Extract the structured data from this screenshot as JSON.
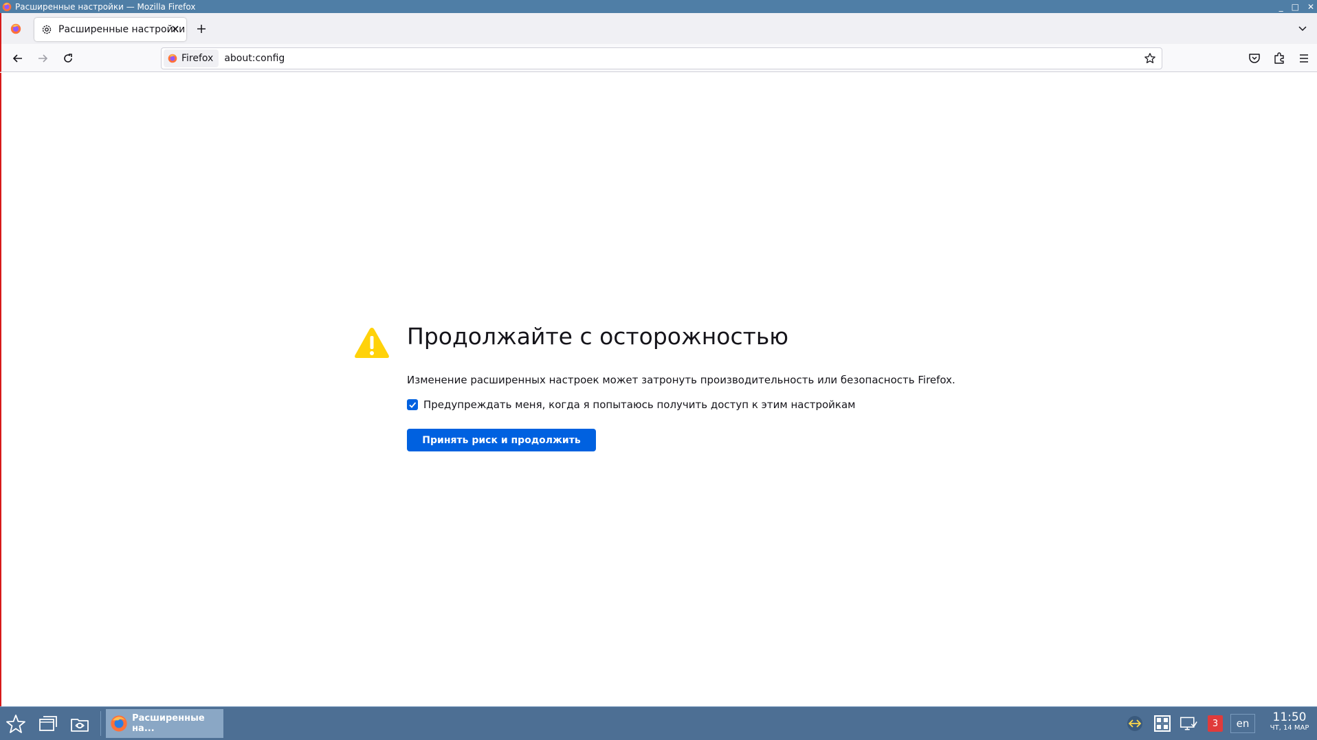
{
  "window": {
    "title": "Расширенные настройки — Mozilla Firefox",
    "controls": [
      "_",
      "□",
      "✕"
    ]
  },
  "tabs": [
    {
      "label": "Расширенные настройки",
      "icon": "gear-icon",
      "active": true
    }
  ],
  "navbar": {
    "identity_label": "Firefox",
    "url": "about:config"
  },
  "page": {
    "heading": "Продолжайте с осторожностью",
    "description": "Изменение расширенных настроек может затронуть производительность или безопасность Firefox.",
    "checkbox_label": "Предупреждать меня, когда я попытаюсь получить доступ к этим настройкам",
    "checkbox_checked": true,
    "accept_button": "Принять риск и продолжить"
  },
  "taskbar": {
    "window_label": "Расширенные на...",
    "notification_count": "3",
    "language": "en",
    "time": "11:50",
    "date": "ЧТ, 14 МАР"
  },
  "colors": {
    "titlebar": "#4f7ea6",
    "accent": "#0061e0",
    "warning": "#ffd20a",
    "taskbar": "#4d6f94"
  }
}
